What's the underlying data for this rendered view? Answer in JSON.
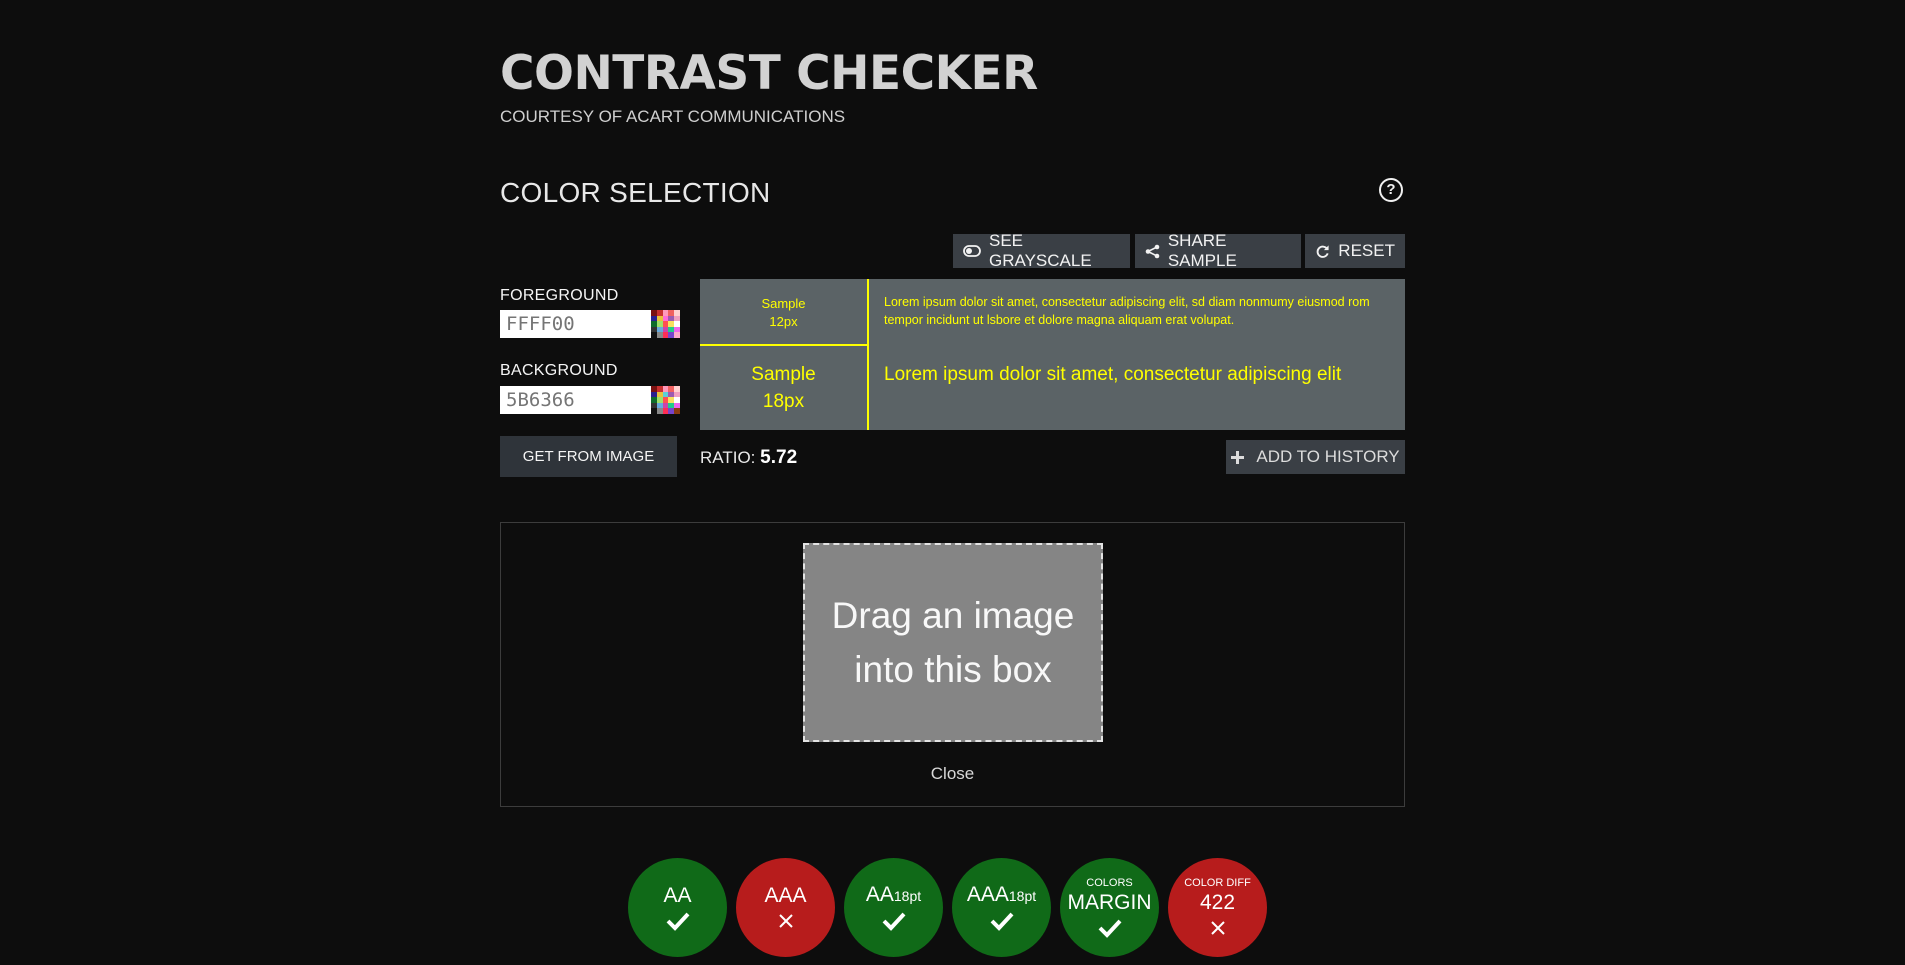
{
  "header": {
    "title": "CONTRAST CHECKER",
    "courtesy": "COURTESY OF ACART COMMUNICATIONS"
  },
  "color_selection": {
    "section_title": "COLOR SELECTION",
    "help_icon": "question-circle-icon",
    "toolbar": {
      "grayscale_label": "SEE GRAYSCALE",
      "share_label": "SHARE SAMPLE",
      "reset_label": "RESET"
    },
    "foreground": {
      "label": "FOREGROUND",
      "placeholder": "FFFF00",
      "color": "#FFFF00"
    },
    "background": {
      "label": "BACKGROUND",
      "placeholder": "5B6366",
      "color": "#5B6366"
    },
    "get_from_image_label": "GET FROM IMAGE"
  },
  "preview": {
    "small_label_line1": "Sample",
    "small_label_line2": "12px",
    "large_label_line1": "Sample",
    "large_label_line2": "18px",
    "small_text": "Lorem ipsum dolor sit amet, consectetur adipiscing elit, sd diam nonmumy eiusmod rom tempor incidunt ut lsbore et dolore magna aliquam erat volupat.",
    "large_text": "Lorem ipsum dolor sit amet, consectetur adipiscing elit"
  },
  "ratio": {
    "label": "RATIO:",
    "value": "5.72"
  },
  "add_history_label": "ADD TO HISTORY",
  "drop_zone": {
    "line1": "Drag an image",
    "line2": "into this box",
    "close_label": "Close"
  },
  "results": {
    "aa": {
      "main": "AA",
      "status": "pass"
    },
    "aaa": {
      "main": "AAA",
      "status": "fail"
    },
    "aa18": {
      "main": "AA",
      "sub": "18pt",
      "status": "pass"
    },
    "aaa18": {
      "main": "AAA",
      "sub": "18pt",
      "status": "pass"
    },
    "colors_margin": {
      "top": "COLORS",
      "main": "MARGIN",
      "status": "pass"
    },
    "color_diff": {
      "top": "COLOR DIFF",
      "main": "422",
      "status": "fail"
    }
  },
  "colors": {
    "page_bg": "#0d0d0d",
    "pass": "#106a18",
    "fail": "#b71c1c",
    "button_bg": "#3a3f45"
  }
}
